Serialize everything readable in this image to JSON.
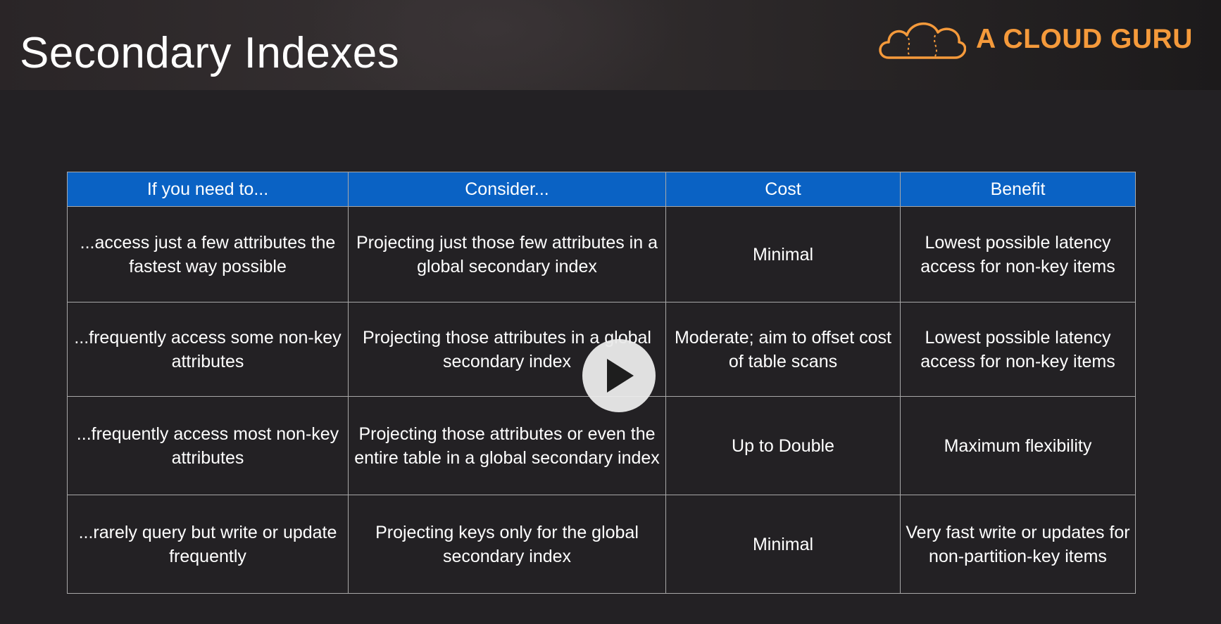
{
  "slide": {
    "title": "Secondary Indexes"
  },
  "logo": {
    "text": "A CLOUD GURU",
    "brand_color": "#f59a3b"
  },
  "table": {
    "header_color": "#0a62c4",
    "columns": [
      "If you need to...",
      "Consider...",
      "Cost",
      "Benefit"
    ],
    "rows": [
      [
        "...access just a few attributes the fastest way possible",
        "Projecting just those few attributes in a global secondary index",
        "Minimal",
        "Lowest possible latency access for non-key items"
      ],
      [
        "...frequently access some non-key attributes",
        "Projecting those attributes in a global secondary index",
        "Moderate; aim to offset cost of table scans",
        "Lowest possible latency access for non-key items"
      ],
      [
        "...frequently access most non-key attributes",
        "Projecting those attributes or even the entire table in a global secondary index",
        "Up to Double",
        "Maximum flexibility"
      ],
      [
        "...rarely query but write or update frequently",
        "Projecting keys only for the global secondary index",
        "Minimal",
        "Very fast write or updates for non-partition-key items"
      ]
    ]
  },
  "player": {
    "play_icon": "play-icon"
  }
}
